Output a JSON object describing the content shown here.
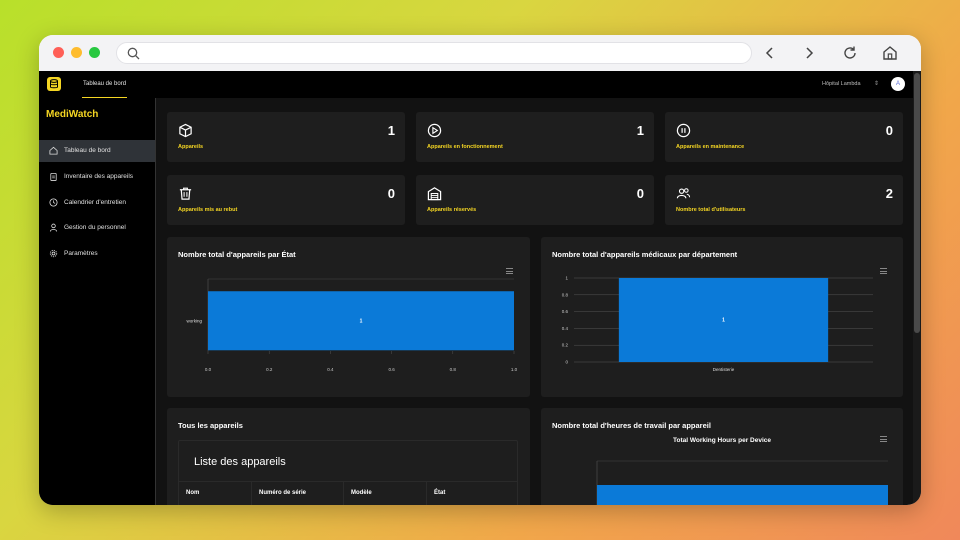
{
  "colors": {
    "accent": "#f5d623",
    "bar": "#0b7ad8",
    "card": "#1e1e1e",
    "bg": "#121212",
    "sidebar": "#000000"
  },
  "header": {
    "tab_label": "Tableau de bord",
    "hospital": "Hôpital Lambda",
    "avatar_letter": "A"
  },
  "sidebar": {
    "brand": "MediWatch",
    "items": [
      {
        "label": "Tableau de bord",
        "icon": "home-icon",
        "active": true
      },
      {
        "label": "Inventaire des appareils",
        "icon": "clipboard-icon",
        "active": false
      },
      {
        "label": "Calendrier d'entretien",
        "icon": "clock-icon",
        "active": false
      },
      {
        "label": "Gestion du personnel",
        "icon": "user-icon",
        "active": false
      },
      {
        "label": "Paramètres",
        "icon": "gear-icon",
        "active": false
      }
    ]
  },
  "stats": [
    {
      "label": "Appareils",
      "value": "1",
      "icon": "box-icon"
    },
    {
      "label": "Appareils en fonctionnement",
      "value": "1",
      "icon": "play-circle-icon"
    },
    {
      "label": "Appareils en maintenance",
      "value": "0",
      "icon": "pause-circle-icon"
    },
    {
      "label": "Appareils mis au rebut",
      "value": "0",
      "icon": "trash-icon"
    },
    {
      "label": "Appareils réservés",
      "value": "0",
      "icon": "warehouse-icon"
    },
    {
      "label": "Nombre total d'utilisateurs",
      "value": "2",
      "icon": "users-icon"
    }
  ],
  "panels": {
    "etat_title": "Nombre total d'appareils par État",
    "dept_title": "Nombre total d'appareils médicaux par département",
    "devices_title": "Tous les appareils",
    "hours_title": "Nombre total d'heures de travail par appareil"
  },
  "device_table": {
    "title": "Liste des appareils",
    "columns": [
      "Nom",
      "Numéro de série",
      "Modèle",
      "État"
    ]
  },
  "chart_data": [
    {
      "type": "bar",
      "orientation": "horizontal",
      "categories": [
        "working"
      ],
      "values": [
        1
      ],
      "data_labels": [
        "1"
      ],
      "xlim": [
        0,
        1
      ],
      "x_ticks": [
        "0.0",
        "0.2",
        "0.4",
        "0.6",
        "0.8",
        "1.0"
      ],
      "grid": false
    },
    {
      "type": "bar",
      "orientation": "vertical",
      "categories": [
        "Dentisterie"
      ],
      "values": [
        1
      ],
      "data_labels": [
        "1"
      ],
      "ylim": [
        0,
        1
      ],
      "y_ticks": [
        "0",
        "0.2",
        "0.4",
        "0.6",
        "0.8",
        "1"
      ],
      "grid": true
    },
    {
      "type": "bar",
      "orientation": "vertical",
      "title": "Total Working Hours per Device",
      "categories": [],
      "values": [],
      "partially_visible": true
    }
  ]
}
